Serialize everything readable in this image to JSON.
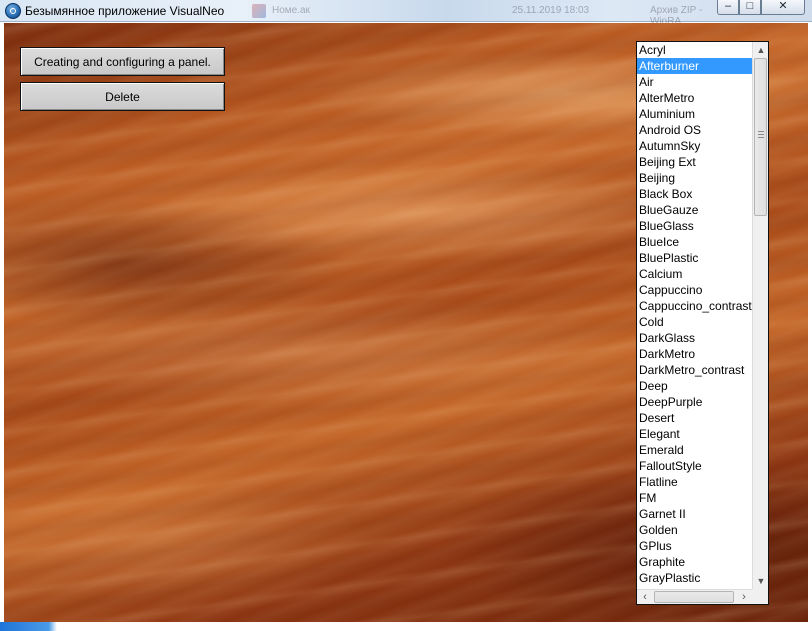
{
  "window": {
    "title": "Безымянное приложение VisualNeo",
    "icon": "app-globe-icon",
    "controls": {
      "minimize": "–",
      "maximize": "□",
      "close": "✕"
    }
  },
  "background_taskbar": {
    "item_label": "Номе.ак",
    "datetime": "25.11.2019 18:03",
    "extra": "Архив ZIP - WinRA..."
  },
  "buttons": {
    "create_label": "Creating and configuring a panel.",
    "delete_label": "Delete"
  },
  "listbox": {
    "selected": "Afterburner",
    "items": [
      "Acryl",
      "Afterburner",
      "Air",
      "AlterMetro",
      "Aluminium",
      "Android OS",
      "AutumnSky",
      "Beijing Ext",
      "Beijing",
      "Black Box",
      "BlueGauze",
      "BlueGlass",
      "BlueIce",
      "BluePlastic",
      "Calcium",
      "Cappuccino",
      "Cappuccino_contrast",
      "Cold",
      "DarkGlass",
      "DarkMetro",
      "DarkMetro_contrast",
      "Deep",
      "DeepPurple",
      "Desert",
      "Elegant",
      "Emerald",
      "FalloutStyle",
      "Flatline",
      "FM",
      "Garnet II",
      "Golden",
      "GPlus",
      "Graphite",
      "GrayPlastic"
    ]
  },
  "scrollbar": {
    "up": "▲",
    "down": "▼",
    "left": "‹",
    "right": "›"
  },
  "colors": {
    "selection": "#3399ff",
    "background_accent": "#b5561f"
  }
}
